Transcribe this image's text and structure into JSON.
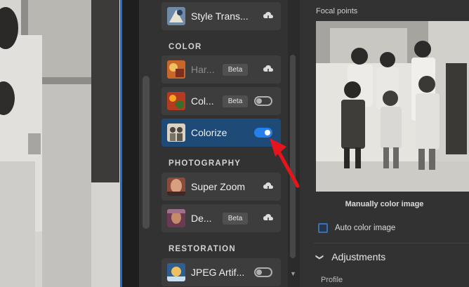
{
  "sections": {
    "color": "COLOR",
    "photography": "PHOTOGRAPHY",
    "restoration": "RESTORATION"
  },
  "filters": {
    "style_transfer": {
      "label": "Style Trans...",
      "icon": "cloud-download-icon"
    },
    "harmonization": {
      "label": "Har...",
      "badge": "Beta",
      "icon": "cloud-download-icon"
    },
    "color_transfer": {
      "label": "Col...",
      "badge": "Beta",
      "toggle": "off"
    },
    "colorize": {
      "label": "Colorize",
      "toggle": "on"
    },
    "super_zoom": {
      "label": "Super Zoom",
      "icon": "cloud-download-icon"
    },
    "depth_blur": {
      "label": "De...",
      "badge": "Beta",
      "icon": "cloud-download-icon"
    },
    "jpeg_artifacts": {
      "label": "JPEG Artif...",
      "toggle": "off"
    }
  },
  "right_panel": {
    "focal_title": "Focal points",
    "manual_color": "Manually color image",
    "auto_color": "Auto color image",
    "adjustments": "Adjustments",
    "profile": "Profile"
  },
  "colors": {
    "active_card": "#1e4a78",
    "toggle_on": "#2680eb",
    "annotation_arrow": "#e8141c"
  }
}
